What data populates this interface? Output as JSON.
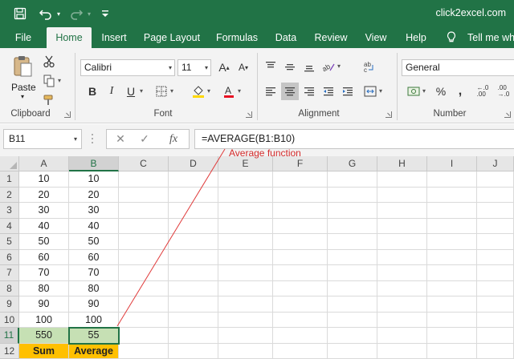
{
  "app": {
    "title": "click2excel.com"
  },
  "quick_access": {
    "save_icon": "save-icon",
    "undo_icon": "undo-icon",
    "redo_icon": "redo-icon",
    "customize_icon": "customize-toolbar-icon"
  },
  "tabs": [
    {
      "label": "File",
      "active": false
    },
    {
      "label": "Home",
      "active": true
    },
    {
      "label": "Insert",
      "active": false
    },
    {
      "label": "Page Layout",
      "active": false
    },
    {
      "label": "Formulas",
      "active": false
    },
    {
      "label": "Data",
      "active": false
    },
    {
      "label": "Review",
      "active": false
    },
    {
      "label": "View",
      "active": false
    },
    {
      "label": "Help",
      "active": false
    }
  ],
  "tell_me": {
    "label": "Tell me wha",
    "icon": "lightbulb-icon"
  },
  "ribbon": {
    "clipboard": {
      "label": "Clipboard",
      "paste_label": "Paste"
    },
    "font": {
      "label": "Font",
      "font_name": "Calibri",
      "font_size": "11"
    },
    "alignment": {
      "label": "Alignment"
    },
    "number": {
      "label": "Number",
      "format": "General"
    }
  },
  "formula_bar": {
    "name_box": "B11",
    "cancel": "✕",
    "enter": "✓",
    "fx": "fx",
    "formula": "=AVERAGE(B1:B10)"
  },
  "annotation": "Average function",
  "colors": {
    "excel_green": "#217346",
    "cell_green": "#c6e0b4",
    "cell_gold": "#ffc000",
    "annotation_red": "#d42b2b"
  },
  "sheet": {
    "columns": [
      "A",
      "B",
      "C",
      "D",
      "E",
      "F",
      "G",
      "H",
      "I",
      "J"
    ],
    "selected_column": "B",
    "selected_row": "11",
    "rows": [
      {
        "num": "1",
        "a": "10",
        "b": "10"
      },
      {
        "num": "2",
        "a": "20",
        "b": "20"
      },
      {
        "num": "3",
        "a": "30",
        "b": "30"
      },
      {
        "num": "4",
        "a": "40",
        "b": "40"
      },
      {
        "num": "5",
        "a": "50",
        "b": "50"
      },
      {
        "num": "6",
        "a": "60",
        "b": "60"
      },
      {
        "num": "7",
        "a": "70",
        "b": "70"
      },
      {
        "num": "8",
        "a": "80",
        "b": "80"
      },
      {
        "num": "9",
        "a": "90",
        "b": "90"
      },
      {
        "num": "10",
        "a": "100",
        "b": "100"
      },
      {
        "num": "11",
        "a": "550",
        "b": "55"
      },
      {
        "num": "12",
        "a": "Sum",
        "b": "Average"
      }
    ]
  }
}
